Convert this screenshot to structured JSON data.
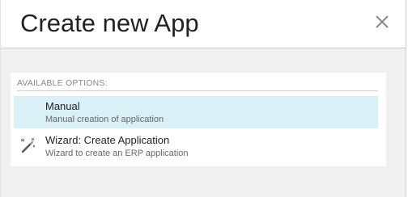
{
  "dialog": {
    "title": "Create new App",
    "close_icon": "close-icon"
  },
  "options_panel": {
    "heading": "AVAILABLE OPTIONS:",
    "options": [
      {
        "title": "Manual",
        "description": "Manual creation of application",
        "icon": "",
        "selected": true
      },
      {
        "title": "Wizard: Create Application",
        "description": "Wizard to create an ERP application",
        "icon": "magic-wand-icon",
        "selected": false
      }
    ]
  },
  "colors": {
    "selected_bg": "#daf0f7",
    "background": "#f0f0f0"
  }
}
